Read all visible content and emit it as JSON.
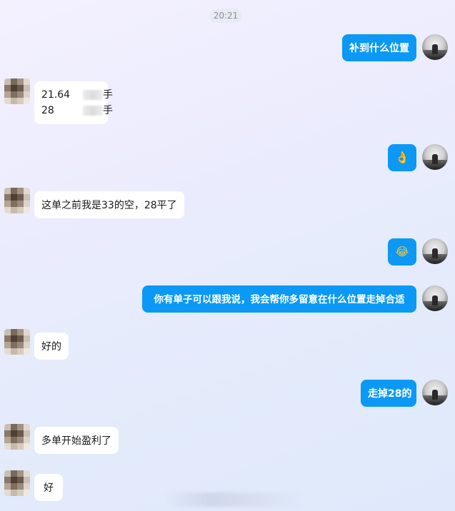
{
  "timestamp": "20:21",
  "colors": {
    "outgoing_bubble": "#0b99f5",
    "incoming_bubble": "#ffffff",
    "background": "#e8ecfc"
  },
  "messages": [
    {
      "side": "out",
      "text": "补到什么位置"
    },
    {
      "side": "in",
      "lines": [
        {
          "value": "21.64",
          "suffix": "手"
        },
        {
          "value": "28",
          "suffix": "手"
        }
      ]
    },
    {
      "side": "out",
      "text": "👌",
      "icon": "ok-hand-emoji"
    },
    {
      "side": "in",
      "text": "这单之前我是33的空，28平了"
    },
    {
      "side": "out",
      "text": "😂",
      "icon": "tears-of-joy-emoji"
    },
    {
      "side": "out",
      "text": "你有单子可以跟我说，我会帮你多留意在什么位置走掉合适"
    },
    {
      "side": "in",
      "text": "好的"
    },
    {
      "side": "out",
      "text": "走掉28的"
    },
    {
      "side": "in",
      "text": "多单开始盈利了"
    },
    {
      "side": "in",
      "text": "好"
    }
  ]
}
